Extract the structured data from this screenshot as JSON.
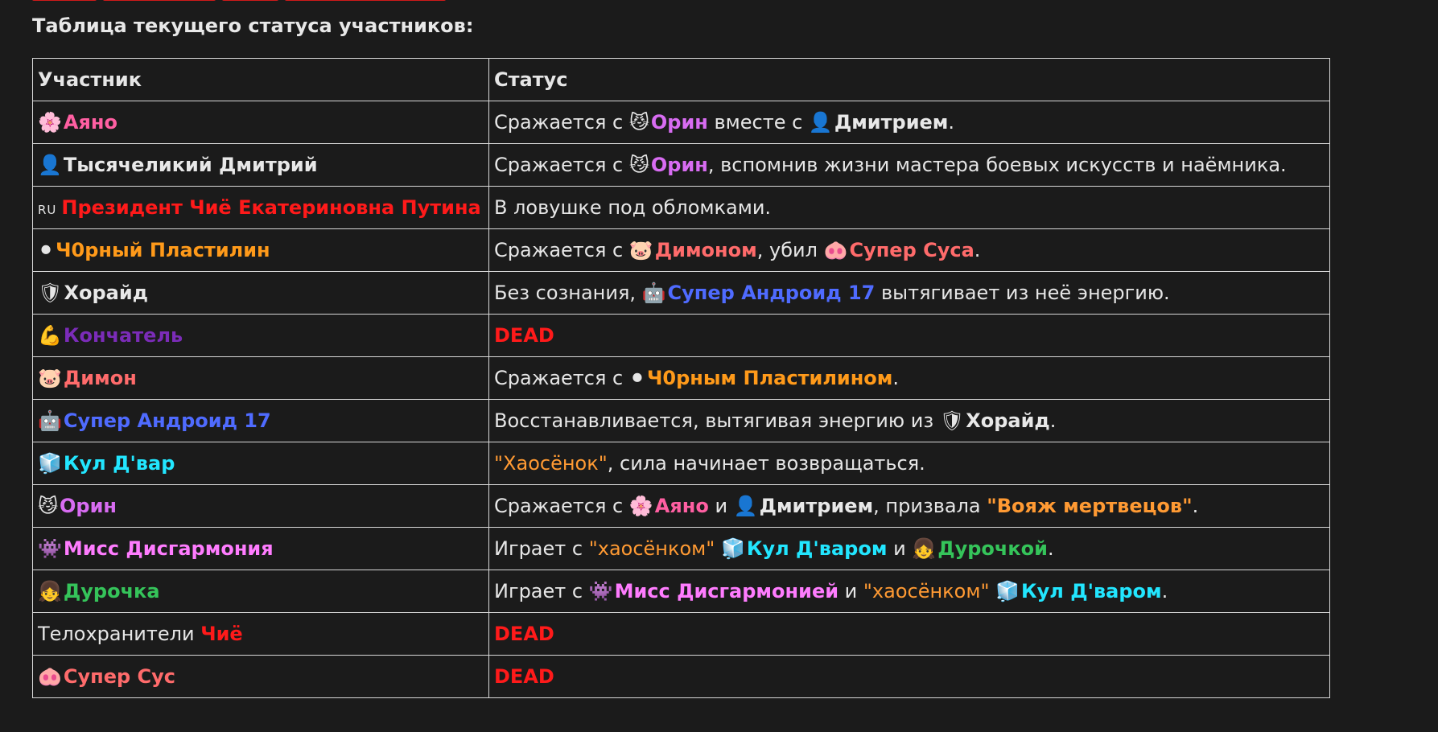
{
  "colors": {
    "background": "#1b1b1b",
    "text": "#e6e6e6",
    "border": "#d8d8d8",
    "pink": "#ff5fa2",
    "violet": "#d86cf2",
    "red": "#ff1a1a",
    "orange": "#ff9a1a",
    "salmon": "#ff6b6b",
    "blue": "#4f6bff",
    "purple": "#7b2cb8",
    "cyan": "#22e6ff",
    "magenta": "#ff7cff",
    "green": "#35c45a",
    "quote": "#ff9a33"
  },
  "heading": "Таблица текущего статуса участников:",
  "table": {
    "headers": [
      "Участник",
      "Статус"
    ],
    "rows": [
      {
        "participant": [
          {
            "t": "🌸",
            "emoji": true,
            "icon": "cherry-blossom-icon"
          },
          {
            "t": "Аяно",
            "c": "pink",
            "b": true
          }
        ],
        "status": [
          {
            "t": "Сражается с "
          },
          {
            "t": "😼",
            "emoji": true,
            "icon": "cat-face-icon"
          },
          {
            "t": "Орин",
            "c": "violet",
            "b": true
          },
          {
            "t": " вместе с "
          },
          {
            "t": "👤",
            "emoji": true,
            "icon": "bust-silhouette-icon"
          },
          {
            "t": "Дмитрием",
            "c": "white",
            "b": true
          },
          {
            "t": "."
          }
        ]
      },
      {
        "participant": [
          {
            "t": "👤",
            "emoji": true,
            "icon": "bust-silhouette-icon"
          },
          {
            "t": "Тысячеликий Дмитрий",
            "c": "white",
            "b": true
          }
        ],
        "status": [
          {
            "t": "Сражается с "
          },
          {
            "t": "😼",
            "emoji": true,
            "icon": "cat-face-icon"
          },
          {
            "t": "Орин",
            "c": "violet",
            "b": true
          },
          {
            "t": ", вспомнив жизни мастера боевых искусств и наёмника."
          }
        ]
      },
      {
        "participant": [
          {
            "t": "RU",
            "flag": true
          },
          {
            "t": "Президент Чиё Екатериновна Путина",
            "c": "red",
            "b": true
          }
        ],
        "status": [
          {
            "t": "В ловушке под обломками."
          }
        ]
      },
      {
        "participant": [
          {
            "t": "⚫",
            "emoji": true,
            "icon": "black-circle-icon"
          },
          {
            "t": "Ч0рный Пластилин",
            "c": "orange",
            "b": true
          }
        ],
        "status": [
          {
            "t": "Сражается с "
          },
          {
            "t": "🐷",
            "emoji": true,
            "icon": "pig-face-icon"
          },
          {
            "t": "Димоном",
            "c": "salmon",
            "b": true
          },
          {
            "t": ", убил "
          },
          {
            "t": "🐽",
            "emoji": true,
            "icon": "pig-nose-icon"
          },
          {
            "t": "Супер Суса",
            "c": "salmon",
            "b": true
          },
          {
            "t": "."
          }
        ]
      },
      {
        "participant": [
          {
            "t": "🛡",
            "emoji": true,
            "icon": "shield-icon"
          },
          {
            "t": "Хорайд",
            "c": "white",
            "b": true
          }
        ],
        "status": [
          {
            "t": "Без сознания, "
          },
          {
            "t": "🤖",
            "emoji": true,
            "icon": "robot-face-icon"
          },
          {
            "t": "Супер Андроид 17",
            "c": "blue",
            "b": true
          },
          {
            "t": " вытягивает из неё энергию."
          }
        ]
      },
      {
        "participant": [
          {
            "t": "💪",
            "emoji": true,
            "icon": "flexed-biceps-icon"
          },
          {
            "t": "Кончатель",
            "c": "purple",
            "b": true
          }
        ],
        "status": [
          {
            "t": "DEAD",
            "c": "red",
            "b": true
          }
        ]
      },
      {
        "participant": [
          {
            "t": "🐷",
            "emoji": true,
            "icon": "pig-face-icon"
          },
          {
            "t": "Димон",
            "c": "salmon",
            "b": true
          }
        ],
        "status": [
          {
            "t": "Сражается с "
          },
          {
            "t": "⚫",
            "emoji": true,
            "icon": "black-circle-icon"
          },
          {
            "t": "Ч0рным Пластилином",
            "c": "orange",
            "b": true
          },
          {
            "t": "."
          }
        ]
      },
      {
        "participant": [
          {
            "t": "🤖",
            "emoji": true,
            "icon": "robot-face-icon"
          },
          {
            "t": "Супер Андроид 17",
            "c": "blue",
            "b": true
          }
        ],
        "status": [
          {
            "t": "Восстанавливается, вытягивая энергию из "
          },
          {
            "t": "🛡",
            "emoji": true,
            "icon": "shield-icon"
          },
          {
            "t": "Хорайд",
            "c": "white",
            "b": true
          },
          {
            "t": "."
          }
        ]
      },
      {
        "participant": [
          {
            "t": "🧊",
            "emoji": true,
            "icon": "ice-cube-icon"
          },
          {
            "t": "Кул Д'вар",
            "c": "cyan",
            "b": true
          }
        ],
        "status": [
          {
            "t": "\"Хаосёнок\"",
            "c": "quote"
          },
          {
            "t": ", сила начинает возвращаться."
          }
        ]
      },
      {
        "participant": [
          {
            "t": "😼",
            "emoji": true,
            "icon": "cat-face-icon"
          },
          {
            "t": "Орин",
            "c": "violet",
            "b": true
          }
        ],
        "status": [
          {
            "t": "Сражается с "
          },
          {
            "t": "🌸",
            "emoji": true,
            "icon": "cherry-blossom-icon"
          },
          {
            "t": "Аяно",
            "c": "pink",
            "b": true
          },
          {
            "t": " и "
          },
          {
            "t": "👤",
            "emoji": true,
            "icon": "bust-silhouette-icon"
          },
          {
            "t": "Дмитрием",
            "c": "white",
            "b": true
          },
          {
            "t": ", призвала "
          },
          {
            "t": "\"Вояж мертвецов\"",
            "c": "quote",
            "b": true
          },
          {
            "t": "."
          }
        ]
      },
      {
        "participant": [
          {
            "t": "👾",
            "emoji": true,
            "icon": "alien-monster-icon"
          },
          {
            "t": "Мисс Дисгармония",
            "c": "magenta",
            "b": true
          }
        ],
        "status": [
          {
            "t": "Играет с "
          },
          {
            "t": "\"хаосёнком\"",
            "c": "quote"
          },
          {
            "t": " "
          },
          {
            "t": "🧊",
            "emoji": true,
            "icon": "ice-cube-icon"
          },
          {
            "t": "Кул Д'варом",
            "c": "cyan",
            "b": true
          },
          {
            "t": " и "
          },
          {
            "t": "👧",
            "emoji": true,
            "icon": "girl-icon"
          },
          {
            "t": "Дурочкой",
            "c": "green",
            "b": true
          },
          {
            "t": "."
          }
        ]
      },
      {
        "participant": [
          {
            "t": "👧",
            "emoji": true,
            "icon": "girl-icon"
          },
          {
            "t": "Дурочка",
            "c": "green",
            "b": true
          }
        ],
        "status": [
          {
            "t": "Играет с "
          },
          {
            "t": "👾",
            "emoji": true,
            "icon": "alien-monster-icon"
          },
          {
            "t": "Мисс Дисгармонией",
            "c": "magenta",
            "b": true
          },
          {
            "t": " и "
          },
          {
            "t": "\"хаосёнком\"",
            "c": "quote"
          },
          {
            "t": " "
          },
          {
            "t": "🧊",
            "emoji": true,
            "icon": "ice-cube-icon"
          },
          {
            "t": "Кул Д'варом",
            "c": "cyan",
            "b": true
          },
          {
            "t": "."
          }
        ]
      },
      {
        "participant": [
          {
            "t": "Телохранители "
          },
          {
            "t": "Чиё",
            "c": "red",
            "b": true
          }
        ],
        "status": [
          {
            "t": "DEAD",
            "c": "red",
            "b": true
          }
        ]
      },
      {
        "participant": [
          {
            "t": "🐽",
            "emoji": true,
            "icon": "pig-nose-icon"
          },
          {
            "t": "Супер Сус",
            "c": "salmon",
            "b": true
          }
        ],
        "status": [
          {
            "t": "DEAD",
            "c": "red",
            "b": true
          }
        ]
      }
    ]
  }
}
